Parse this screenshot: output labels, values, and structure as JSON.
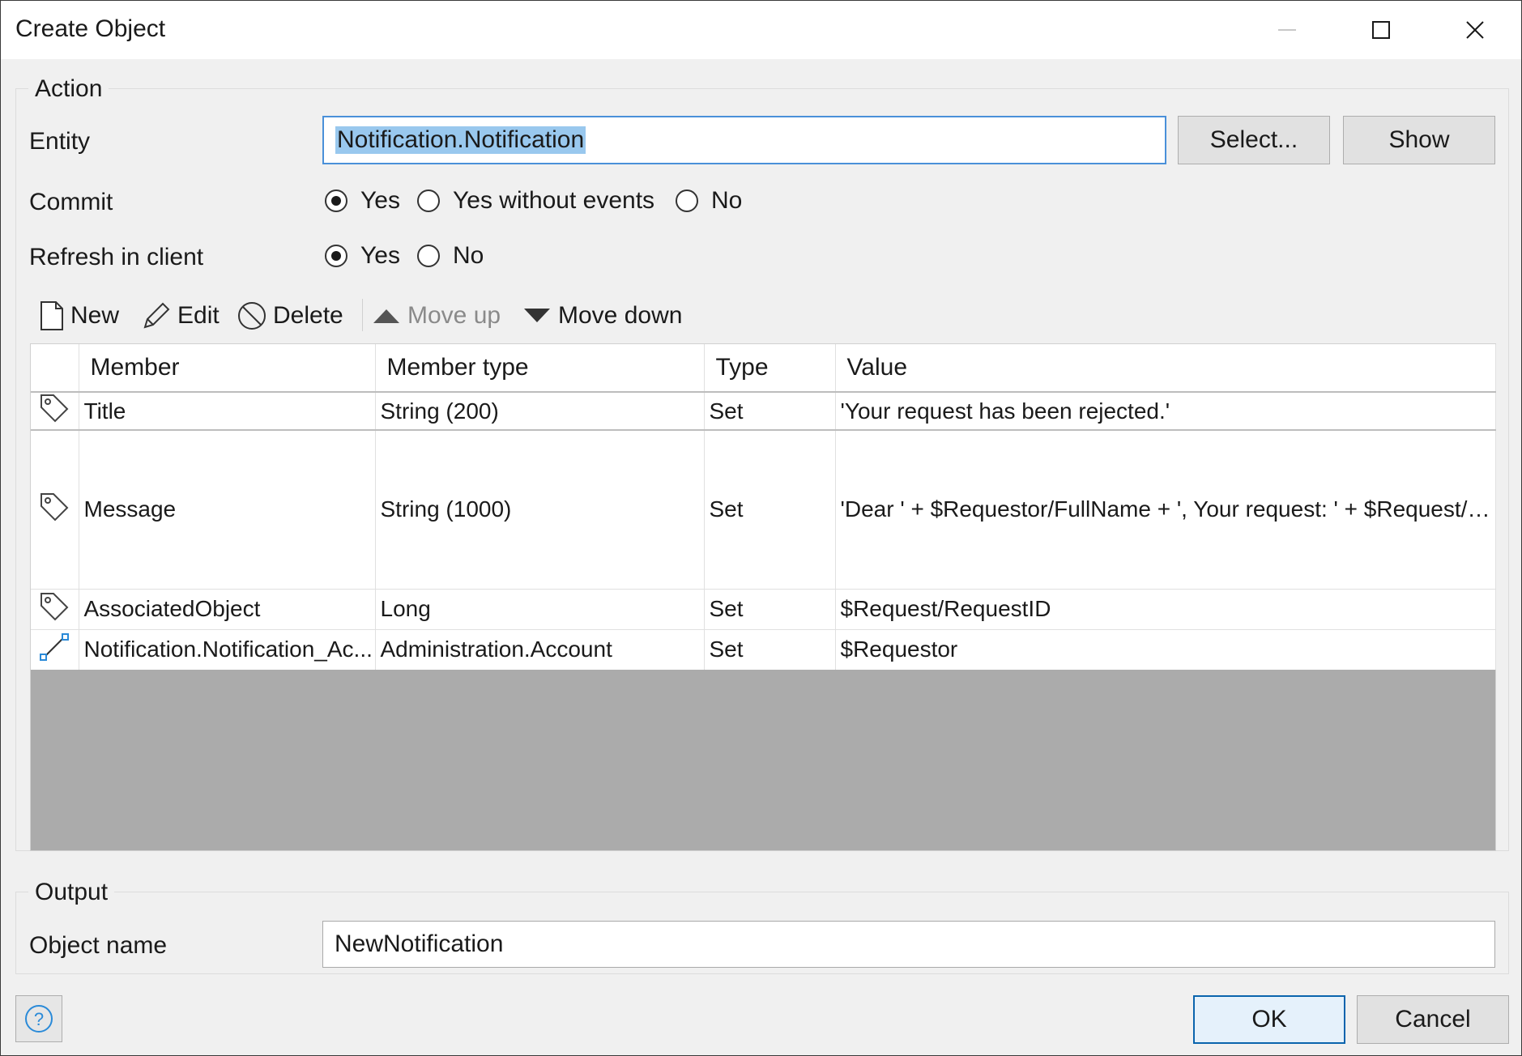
{
  "window": {
    "title": "Create Object",
    "minimize_icon": "minimize-icon",
    "maximize_icon": "maximize-icon",
    "close_icon": "close-icon"
  },
  "action": {
    "legend": "Action",
    "entity_label": "Entity",
    "entity_value": "Notification.Notification",
    "select_button": "Select...",
    "show_button": "Show",
    "commit_label": "Commit",
    "commit_options": [
      {
        "label": "Yes",
        "checked": true
      },
      {
        "label": "Yes without events",
        "checked": false
      },
      {
        "label": "No",
        "checked": false
      }
    ],
    "refresh_label": "Refresh in client",
    "refresh_options": [
      {
        "label": "Yes",
        "checked": true
      },
      {
        "label": "No",
        "checked": false
      }
    ]
  },
  "toolbar": {
    "new": "New",
    "edit": "Edit",
    "delete": "Delete",
    "move_up": "Move up",
    "move_down": "Move down"
  },
  "table": {
    "columns": [
      "Member",
      "Member type",
      "Type",
      "Value"
    ],
    "rows": [
      {
        "icon": "tag-icon",
        "member": "Title",
        "member_type": "String (200)",
        "type": "Set",
        "value": "'Your request has been rejected.'"
      },
      {
        "icon": "tag-icon",
        "member": "Message",
        "member_type": "String (1000)",
        "type": "Set",
        "value": "'Dear ' + $Requestor/FullName + ',\n\nYour request: ' + $Request/Title + ' has been rejected on '\n+ formatDateTime([%CurrentDateTime%],'MM/dd/yyyy')\n+ ' by ' + $Approver/FullName + ' for the following reason: '"
      },
      {
        "icon": "tag-icon",
        "member": "AssociatedObject",
        "member_type": "Long",
        "type": "Set",
        "value": "$Request/RequestID"
      },
      {
        "icon": "association-icon",
        "member": "Notification.Notification_Ac...",
        "member_type": "Administration.Account",
        "type": "Set",
        "value": "$Requestor"
      }
    ]
  },
  "output": {
    "legend": "Output",
    "object_name_label": "Object name",
    "object_name_value": "NewNotification"
  },
  "footer": {
    "help_icon": "help-icon",
    "ok": "OK",
    "cancel": "Cancel"
  },
  "colors": {
    "accent": "#0a64ad",
    "selection": "#99c8ee",
    "empty_grid": "#ababab"
  }
}
